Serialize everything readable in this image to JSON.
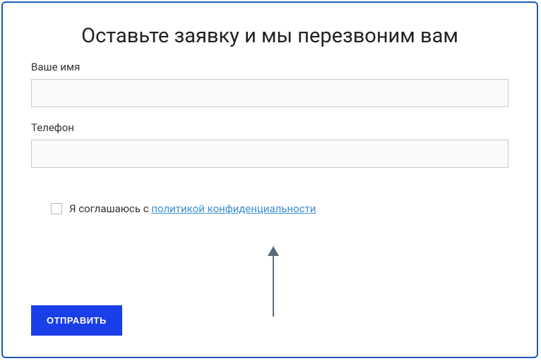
{
  "form": {
    "title": "Оставьте заявку и мы перезвоним вам",
    "name_label": "Ваше имя",
    "name_value": "",
    "phone_label": "Телефон",
    "phone_value": "",
    "consent_text": "Я соглашаюсь с ",
    "consent_link": "политикой конфиденциальности",
    "submit_label": "ОТПРАВИТЬ"
  }
}
